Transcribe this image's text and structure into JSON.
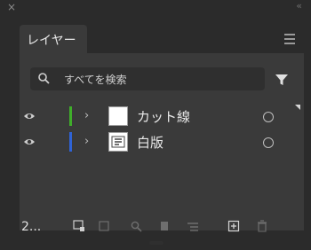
{
  "window": {
    "close_glyph": "×",
    "collapse_glyph": "«"
  },
  "tabs": [
    {
      "label": "レイヤー"
    }
  ],
  "search": {
    "placeholder": "すべてを検索"
  },
  "layers": [
    {
      "name": "カット線",
      "color": "#3fae2a",
      "visible": true
    },
    {
      "name": "白版",
      "color": "#2f63d6",
      "visible": true
    }
  ],
  "footer": {
    "layer_count": "2..."
  },
  "icons": {
    "menu": "hamburger-menu-icon",
    "search": "search-icon",
    "filter": "filter-icon",
    "eye": "eye-icon",
    "expand": "chevron-right-icon",
    "target": "target-circle-icon"
  }
}
